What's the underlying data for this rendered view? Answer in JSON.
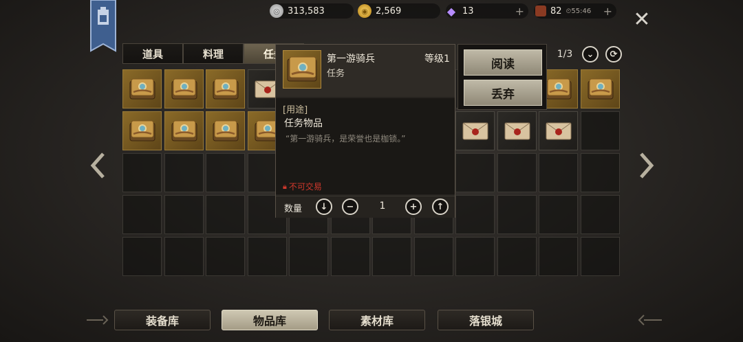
{
  "currency": {
    "silver": "313,583",
    "gold": "2,569",
    "gem": "13",
    "stamina": "82",
    "stamina_timer": "55:46"
  },
  "tabs": [
    {
      "label": "道具"
    },
    {
      "label": "料理"
    },
    {
      "label": "任务"
    }
  ],
  "pagination": "1/3",
  "grid": {
    "rows": [
      [
        "book",
        "book",
        "book",
        "letter",
        "",
        "",
        "",
        "",
        "",
        "book",
        "book",
        "book"
      ],
      [
        "book",
        "book",
        "book",
        "book",
        "",
        "",
        "",
        "",
        "letter",
        "letter",
        "letter",
        ""
      ],
      [
        "",
        "",
        "",
        "",
        "",
        "",
        "",
        "",
        "",
        "",
        "",
        ""
      ],
      [
        "",
        "",
        "",
        "",
        "",
        "",
        "",
        "",
        "",
        "",
        "",
        ""
      ],
      [
        "",
        "",
        "",
        "",
        "",
        "",
        "",
        "",
        "",
        "",
        "",
        ""
      ]
    ]
  },
  "tooltip": {
    "name": "第一游骑兵",
    "level": "等级1",
    "type": "任务",
    "usage_header": "[用途]",
    "usage": "任务物品",
    "description": "“第一游骑兵，是荣誉也是枷锁。”",
    "trade_restriction": "不可交易",
    "quantity_label": "数量",
    "quantity": "1"
  },
  "actions": {
    "read": "阅读",
    "discard": "丢弃"
  },
  "bottom_nav": [
    {
      "label": "装备库"
    },
    {
      "label": "物品库"
    },
    {
      "label": "素材库"
    },
    {
      "label": "落银城"
    }
  ],
  "colors": {
    "gold_slot": "#8a6a28",
    "restriction_red": "#d0382c",
    "button_light": "#bfb9a7"
  }
}
